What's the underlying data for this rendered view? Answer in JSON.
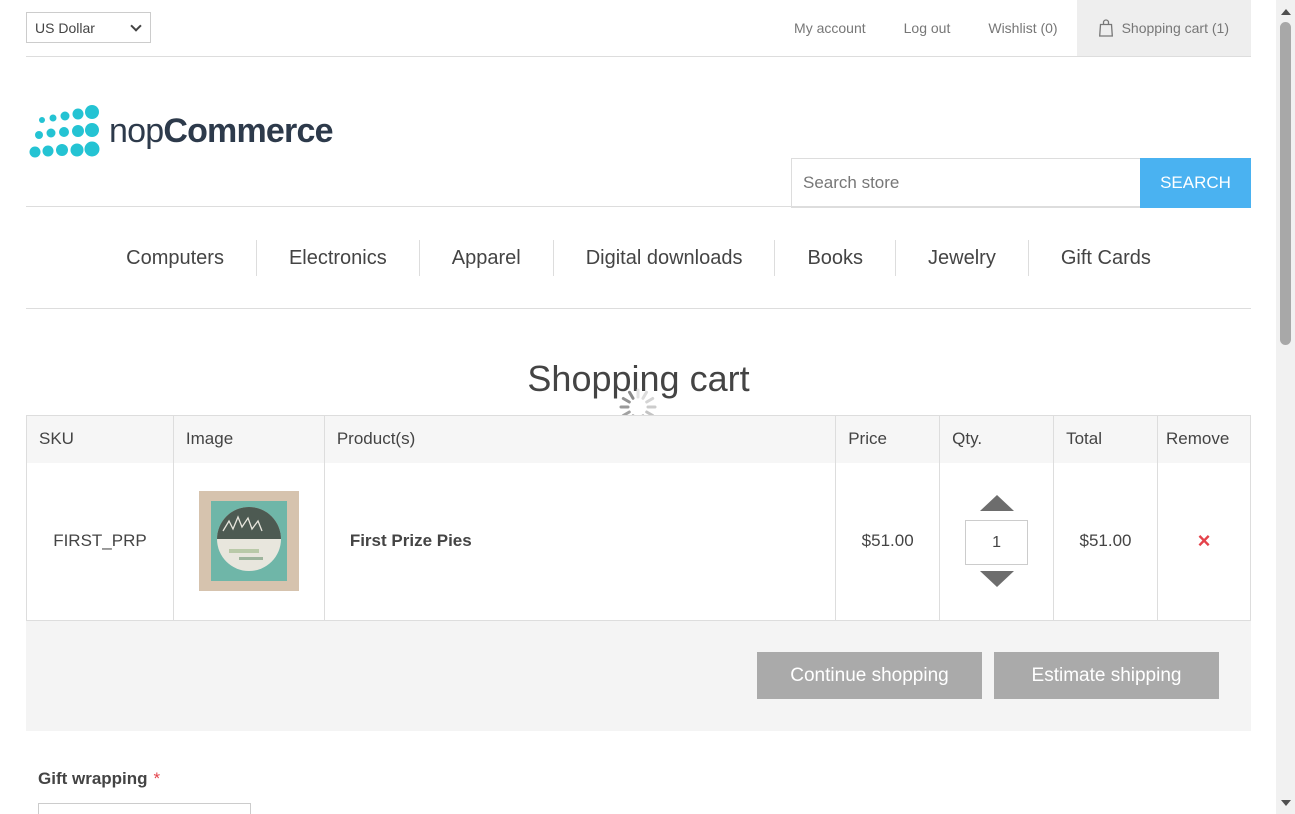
{
  "header": {
    "currency": "US Dollar",
    "links": {
      "my_account": "My account",
      "log_out": "Log out",
      "wishlist": "Wishlist (0)",
      "cart": "Shopping cart (1)"
    }
  },
  "logo": {
    "text_light": "nop",
    "text_bold": "Commerce"
  },
  "search": {
    "placeholder": "Search store",
    "button": "SEARCH"
  },
  "menu": [
    "Computers",
    "Electronics",
    "Apparel",
    "Digital downloads",
    "Books",
    "Jewelry",
    "Gift Cards"
  ],
  "page_title": "Shopping cart",
  "table": {
    "headers": [
      "SKU",
      "Image",
      "Product(s)",
      "Price",
      "Qty.",
      "Total",
      "Remove"
    ],
    "rows": [
      {
        "sku": "FIRST_PRP",
        "product": "First Prize Pies",
        "price": "$51.00",
        "qty": "1",
        "total": "$51.00",
        "remove_icon": "×"
      }
    ]
  },
  "buttons": {
    "continue": "Continue shopping",
    "estimate": "Estimate shipping"
  },
  "gift_wrapping": {
    "label": "Gift wrapping",
    "required_marker": "*"
  },
  "colors": {
    "accent": "#4ab2f1",
    "remove": "#e4434b",
    "button_gray": "#aaaaaa",
    "logo_dots": "#24c3d3"
  }
}
